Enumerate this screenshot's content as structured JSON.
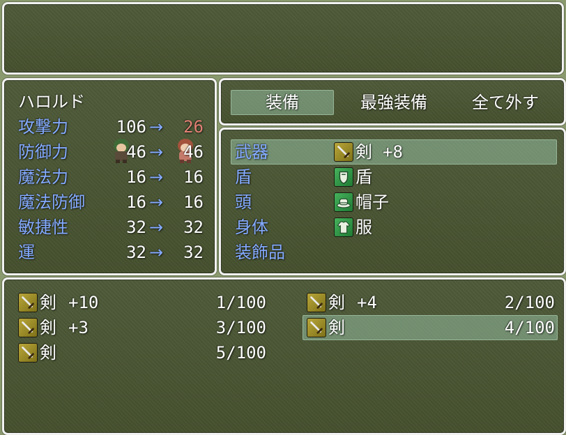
{
  "actor": {
    "name": "ハロルド",
    "params": [
      {
        "label": "攻撃力",
        "current": "106",
        "arrow": "→",
        "new": "26",
        "state": "down"
      },
      {
        "label": "防御力",
        "current": "46",
        "arrow": "→",
        "new": "46",
        "state": "same"
      },
      {
        "label": "魔法力",
        "current": "16",
        "arrow": "→",
        "new": "16",
        "state": "same"
      },
      {
        "label": "魔法防御",
        "current": "16",
        "arrow": "→",
        "new": "16",
        "state": "same"
      },
      {
        "label": "敏捷性",
        "current": "32",
        "arrow": "→",
        "new": "32",
        "state": "same"
      },
      {
        "label": "運",
        "current": "32",
        "arrow": "→",
        "new": "32",
        "state": "same"
      }
    ]
  },
  "commands": [
    {
      "label": "装備",
      "selected": true
    },
    {
      "label": "最強装備",
      "selected": false
    },
    {
      "label": "全て外す",
      "selected": false
    }
  ],
  "slots": [
    {
      "slot": "武器",
      "icon": "sword-icon",
      "item": "剣",
      "bonus": "+8",
      "selected": true
    },
    {
      "slot": "盾",
      "icon": "shield-icon",
      "item": "盾",
      "bonus": "",
      "selected": false
    },
    {
      "slot": "頭",
      "icon": "hat-icon",
      "item": "帽子",
      "bonus": "",
      "selected": false
    },
    {
      "slot": "身体",
      "icon": "clothes-icon",
      "item": "服",
      "bonus": "",
      "selected": false
    },
    {
      "slot": "装飾品",
      "icon": "",
      "item": "",
      "bonus": "",
      "selected": false
    }
  ],
  "items": [
    {
      "icon": "sword-icon",
      "name": "剣",
      "bonus": "+10",
      "count": "1/100",
      "selected": false
    },
    {
      "icon": "sword-icon",
      "name": "剣",
      "bonus": "+4",
      "count": "2/100",
      "selected": false
    },
    {
      "icon": "sword-icon",
      "name": "剣",
      "bonus": "+3",
      "count": "3/100",
      "selected": false
    },
    {
      "icon": "sword-icon",
      "name": "剣",
      "bonus": "",
      "count": "4/100",
      "selected": true
    },
    {
      "icon": "sword-icon",
      "name": "剣",
      "bonus": "",
      "count": "5/100",
      "selected": false
    }
  ],
  "colors": {
    "system": "#84aaff",
    "decrease": "#e08074",
    "normal": "#ffffff",
    "window_border": "#f2f2f2",
    "window_bg": "#4b5635",
    "cursor": "#8ec8a4"
  }
}
